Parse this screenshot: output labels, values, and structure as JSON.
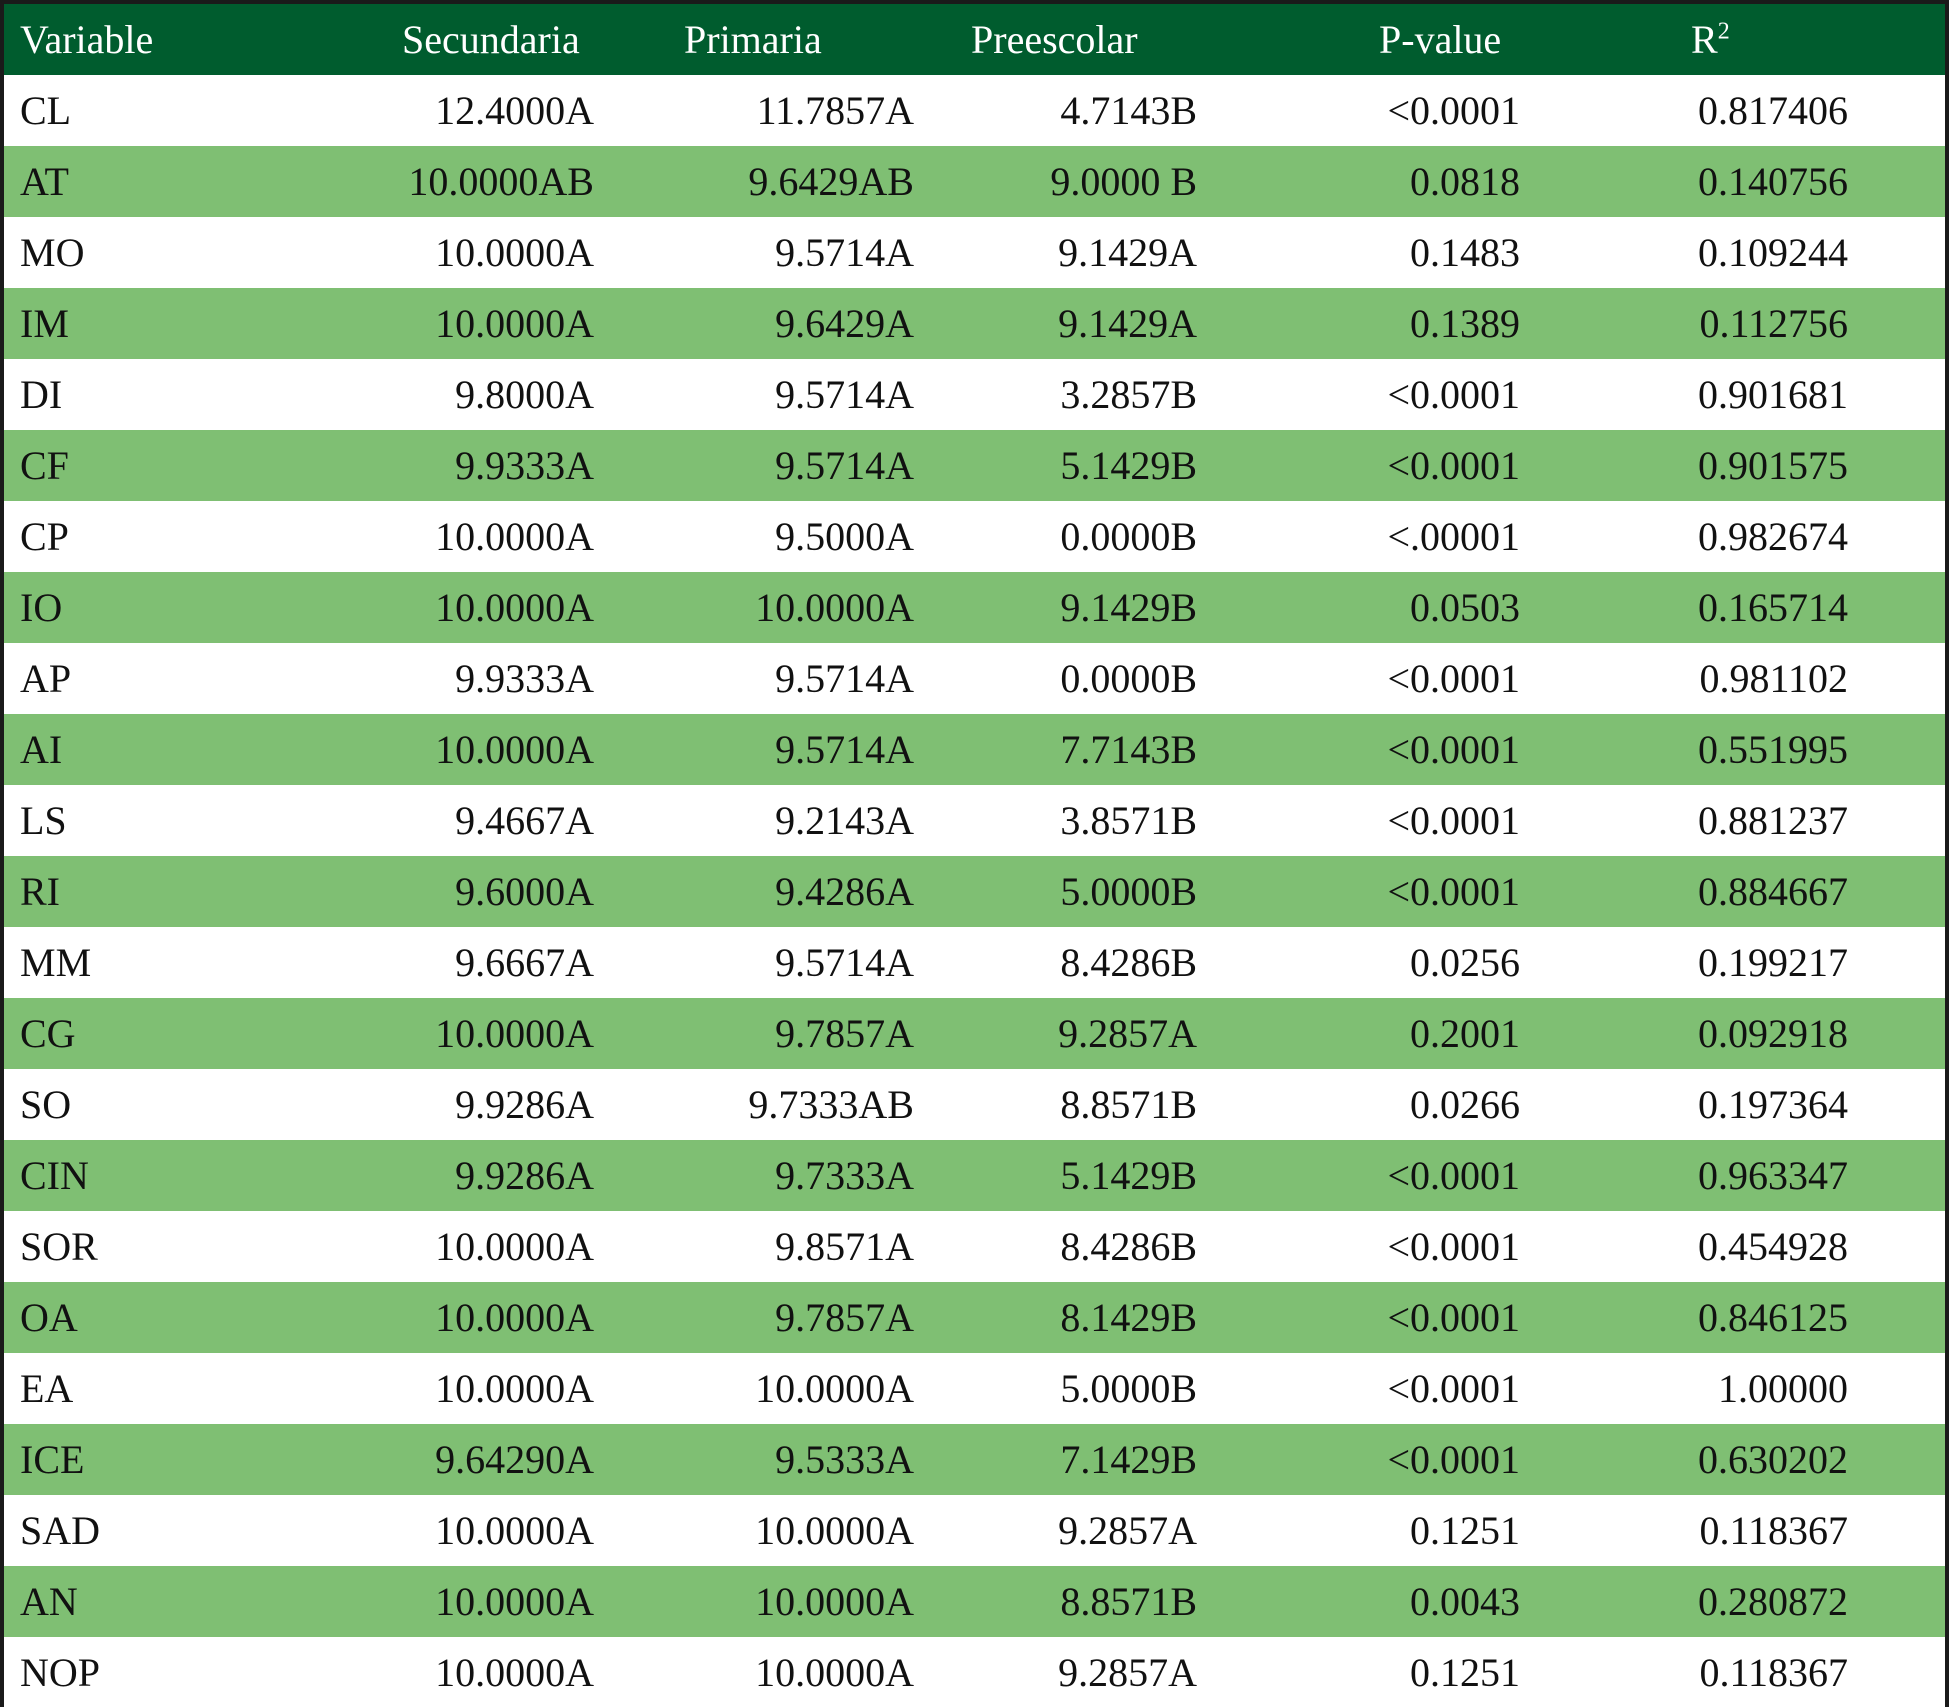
{
  "headers": {
    "variable": "Variable",
    "secundaria": "Secundaria",
    "primaria": "Primaria",
    "preescolar": "Preescolar",
    "pvalue": "P-value",
    "r2_base": "R",
    "r2_sup": "2"
  },
  "rows": [
    {
      "variable": "CL",
      "secundaria": "12.4000A",
      "primaria": "11.7857A",
      "preescolar": "4.7143B",
      "pvalue": "<0.0001",
      "r2": "0.817406"
    },
    {
      "variable": "AT",
      "secundaria": "10.0000AB",
      "primaria": "9.6429AB",
      "preescolar": "9.0000 B",
      "pvalue": "0.0818",
      "r2": "0.140756"
    },
    {
      "variable": "MO",
      "secundaria": "10.0000A",
      "primaria": "9.5714A",
      "preescolar": "9.1429A",
      "pvalue": "0.1483",
      "r2": "0.109244"
    },
    {
      "variable": "IM",
      "secundaria": "10.0000A",
      "primaria": "9.6429A",
      "preescolar": "9.1429A",
      "pvalue": "0.1389",
      "r2": "0.112756"
    },
    {
      "variable": "DI",
      "secundaria": "9.8000A",
      "primaria": "9.5714A",
      "preescolar": "3.2857B",
      "pvalue": "<0.0001",
      "r2": "0.901681"
    },
    {
      "variable": "CF",
      "secundaria": "9.9333A",
      "primaria": "9.5714A",
      "preescolar": "5.1429B",
      "pvalue": "<0.0001",
      "r2": "0.901575"
    },
    {
      "variable": "CP",
      "secundaria": "10.0000A",
      "primaria": "9.5000A",
      "preescolar": "0.0000B",
      "pvalue": "<.00001",
      "r2": "0.982674"
    },
    {
      "variable": "IO",
      "secundaria": "10.0000A",
      "primaria": "10.0000A",
      "preescolar": "9.1429B",
      "pvalue": "0.0503",
      "r2": "0.165714"
    },
    {
      "variable": "AP",
      "secundaria": "9.9333A",
      "primaria": "9.5714A",
      "preescolar": "0.0000B",
      "pvalue": "<0.0001",
      "r2": "0.981102"
    },
    {
      "variable": "AI",
      "secundaria": "10.0000A",
      "primaria": "9.5714A",
      "preescolar": "7.7143B",
      "pvalue": "<0.0001",
      "r2": "0.551995"
    },
    {
      "variable": "LS",
      "secundaria": "9.4667A",
      "primaria": "9.2143A",
      "preescolar": "3.8571B",
      "pvalue": "<0.0001",
      "r2": "0.881237"
    },
    {
      "variable": "RI",
      "secundaria": "9.6000A",
      "primaria": "9.4286A",
      "preescolar": "5.0000B",
      "pvalue": "<0.0001",
      "r2": "0.884667"
    },
    {
      "variable": "MM",
      "secundaria": "9.6667A",
      "primaria": "9.5714A",
      "preescolar": "8.4286B",
      "pvalue": "0.0256",
      "r2": "0.199217"
    },
    {
      "variable": "CG",
      "secundaria": "10.0000A",
      "primaria": "9.7857A",
      "preescolar": "9.2857A",
      "pvalue": "0.2001",
      "r2": "0.092918"
    },
    {
      "variable": "SO",
      "secundaria": "9.9286A",
      "primaria": "9.7333AB",
      "preescolar": "8.8571B",
      "pvalue": "0.0266",
      "r2": "0.197364"
    },
    {
      "variable": "CIN",
      "secundaria": "9.9286A",
      "primaria": "9.7333A",
      "preescolar": "5.1429B",
      "pvalue": "<0.0001",
      "r2": "0.963347"
    },
    {
      "variable": "SOR",
      "secundaria": "10.0000A",
      "primaria": "9.8571A",
      "preescolar": "8.4286B",
      "pvalue": "<0.0001",
      "r2": "0.454928"
    },
    {
      "variable": "OA",
      "secundaria": "10.0000A",
      "primaria": "9.7857A",
      "preescolar": "8.1429B",
      "pvalue": "<0.0001",
      "r2": "0.846125"
    },
    {
      "variable": "EA",
      "secundaria": "10.0000A",
      "primaria": "10.0000A",
      "preescolar": "5.0000B",
      "pvalue": "<0.0001",
      "r2": "1.00000"
    },
    {
      "variable": "ICE",
      "secundaria": "9.64290A",
      "primaria": "9.5333A",
      "preescolar": "7.1429B",
      "pvalue": "<0.0001",
      "r2": "0.630202"
    },
    {
      "variable": "SAD",
      "secundaria": "10.0000A",
      "primaria": "10.0000A",
      "preescolar": "9.2857A",
      "pvalue": "0.1251",
      "r2": "0.118367"
    },
    {
      "variable": "AN",
      "secundaria": "10.0000A",
      "primaria": "10.0000A",
      "preescolar": "8.8571B",
      "pvalue": "0.0043",
      "r2": "0.280872"
    },
    {
      "variable": "NOP",
      "secundaria": "10.0000A",
      "primaria": "10.0000A",
      "preescolar": "9.2857A",
      "pvalue": "0.1251",
      "r2": "0.118367"
    }
  ],
  "colors": {
    "header_bg": "#005c2e",
    "header_text": "#ffffff",
    "stripe": "#7fbf73",
    "row_bg": "#ffffff",
    "border": "#1a1a1a"
  }
}
